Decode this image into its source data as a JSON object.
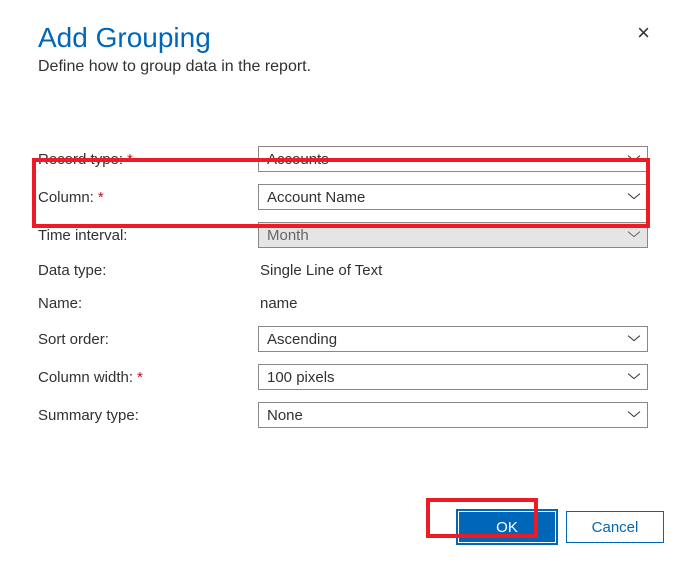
{
  "dialog": {
    "title": "Add Grouping",
    "subtitle": "Define how to group data in the report.",
    "close_label": "×"
  },
  "fields": {
    "record_type": {
      "label": "Record type:",
      "value": "Accounts",
      "required": true
    },
    "column": {
      "label": "Column:",
      "value": "Account Name",
      "required": true
    },
    "time_interval": {
      "label": "Time interval:",
      "value": "Month",
      "disabled": true
    },
    "data_type": {
      "label": "Data type:",
      "value": "Single Line of Text"
    },
    "name": {
      "label": "Name:",
      "value": "name"
    },
    "sort_order": {
      "label": "Sort order:",
      "value": "Ascending"
    },
    "column_width": {
      "label": "Column width:",
      "value": "100 pixels",
      "required": true
    },
    "summary_type": {
      "label": "Summary type:",
      "value": "None"
    }
  },
  "buttons": {
    "ok": "OK",
    "cancel": "Cancel"
  },
  "colors": {
    "accent": "#0067b8",
    "error": "#c50f1f",
    "highlight": "#ed1c24"
  }
}
